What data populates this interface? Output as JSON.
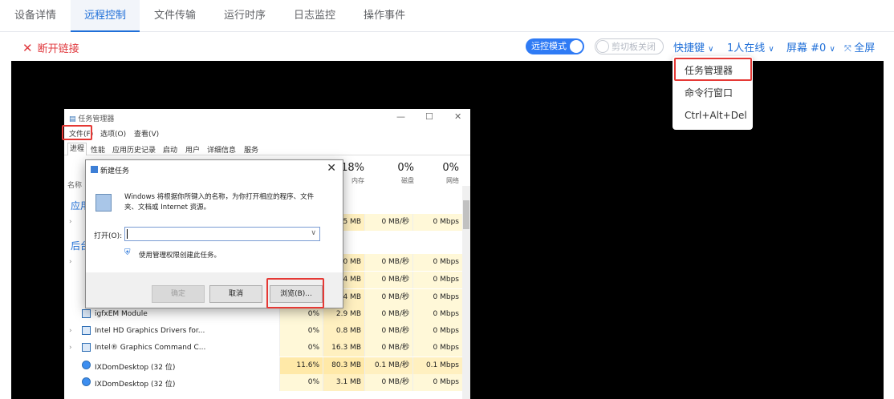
{
  "tabs": [
    {
      "label": "设备详情"
    },
    {
      "label": "远程控制"
    },
    {
      "label": "文件传输"
    },
    {
      "label": "运行时序"
    },
    {
      "label": "日志监控"
    },
    {
      "label": "操作事件"
    }
  ],
  "toolbar": {
    "disconnect_label": "断开链接",
    "remote_mode_label": "远控模式",
    "remote_mode_on": true,
    "clipboard_label": "剪切板关闭",
    "clipboard_on": false,
    "shortcut_label": "快捷键",
    "online_label": "1人在线",
    "screen_label": "屏幕 #0",
    "fullscreen_label": "全屏"
  },
  "shortcut_menu": {
    "items": [
      "任务管理器",
      "命令行窗口",
      "Ctrl+Alt+Del"
    ],
    "highlighted": "任务管理器"
  },
  "colors": {
    "accent": "#1f6fd8",
    "danger": "#e0393e",
    "highlight_box": "#e53935"
  },
  "task_manager": {
    "title": "任务管理器",
    "controls": [
      "—",
      "☐",
      "✕"
    ],
    "menu": [
      "文件(F)",
      "选项(O)",
      "查看(V)"
    ],
    "tabs": [
      "进程",
      "性能",
      "应用历史记录",
      "启动",
      "用户",
      "详细信息",
      "服务"
    ],
    "col_name_label": "名称",
    "group_apps_label": "应用",
    "group_bg_label": "后台",
    "columns": [
      {
        "pct": "18%",
        "name": "内存"
      },
      {
        "pct": "0%",
        "name": "磁盘"
      },
      {
        "pct": "0%",
        "name": "网络"
      }
    ],
    "rows": [
      {
        "name": "",
        "cpu": "",
        "mem": "1.5 MB",
        "disk": "0 MB/秒",
        "net": "0 Mbps",
        "arrow": true
      },
      {
        "name": "",
        "cpu": "",
        "mem": "1.0 MB",
        "disk": "0 MB/秒",
        "net": "0 Mbps",
        "arrow": true
      },
      {
        "name": "",
        "cpu": "",
        "mem": "5.4 MB",
        "disk": "0 MB/秒",
        "net": "0 Mbps",
        "arrow": false
      },
      {
        "name": "",
        "cpu": "",
        "mem": "1.4 MB",
        "disk": "0 MB/秒",
        "net": "0 Mbps",
        "arrow": false
      },
      {
        "name": "igfxEM Module",
        "cpu": "0%",
        "mem": "2.9 MB",
        "disk": "0 MB/秒",
        "net": "0 Mbps",
        "arrow": false
      },
      {
        "name": "Intel HD Graphics Drivers for...",
        "cpu": "0%",
        "mem": "0.8 MB",
        "disk": "0 MB/秒",
        "net": "0 Mbps",
        "arrow": true
      },
      {
        "name": "Intel® Graphics Command C...",
        "cpu": "0%",
        "mem": "16.3 MB",
        "disk": "0 MB/秒",
        "net": "0 Mbps",
        "arrow": true
      },
      {
        "name": "IXDomDesktop (32 位)",
        "cpu": "11.6%",
        "mem": "80.3 MB",
        "disk": "0.1 MB/秒",
        "net": "0.1 Mbps",
        "arrow": false
      },
      {
        "name": "IXDomDesktop (32 位)",
        "cpu": "0%",
        "mem": "3.1 MB",
        "disk": "0 MB/秒",
        "net": "0 Mbps",
        "arrow": false
      }
    ]
  },
  "new_task_dialog": {
    "title": "新建任务",
    "message": "Windows 将根据你所键入的名称，为你打开相应的程序、文件夹、文档或 Internet 资源。",
    "open_label": "打开(O):",
    "open_value": "",
    "admin_label": "使用管理权限创建此任务。",
    "ok_label": "确定",
    "cancel_label": "取消",
    "browse_label": "浏览(B)..."
  }
}
